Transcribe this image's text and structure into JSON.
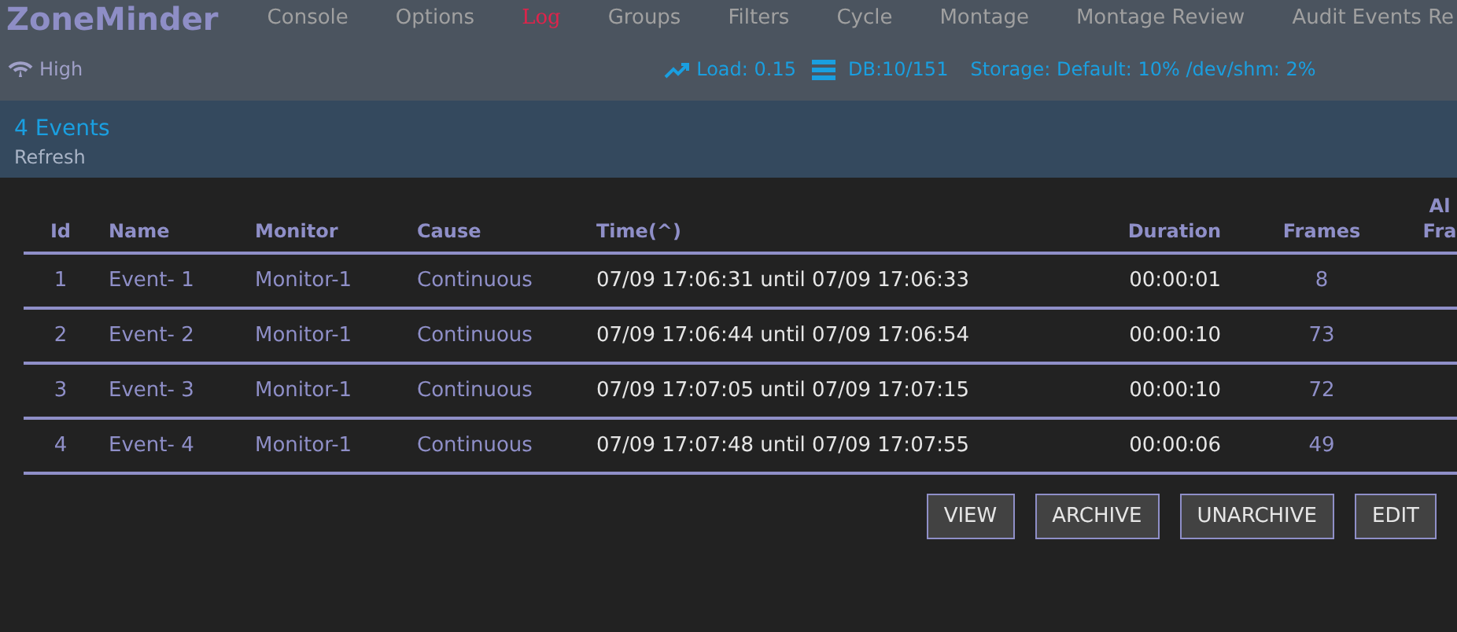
{
  "app_title": "ZoneMinder",
  "nav": [
    {
      "label": "Console",
      "selected": false
    },
    {
      "label": "Options",
      "selected": false
    },
    {
      "label": "Log",
      "selected": true
    },
    {
      "label": "Groups",
      "selected": false
    },
    {
      "label": "Filters",
      "selected": false
    },
    {
      "label": "Cycle",
      "selected": false
    },
    {
      "label": "Montage",
      "selected": false
    },
    {
      "label": "Montage Review",
      "selected": false
    },
    {
      "label": "Audit Events Re",
      "selected": false
    }
  ],
  "status": {
    "bandwidth": "High",
    "load": "Load: 0.15",
    "db": "DB:10/151",
    "storage": "Storage: Default: 10% /dev/shm: 2%"
  },
  "events_title": "4 Events",
  "refresh": "Refresh",
  "table": {
    "columns": [
      "Id",
      "Name",
      "Monitor",
      "Cause",
      "Time(^)",
      "Duration",
      "Frames",
      [
        "Al",
        "Fra"
      ]
    ],
    "rows": [
      [
        "1",
        "Event- 1",
        "Monitor-1",
        "Continuous",
        "07/09 17:06:31 until 07/09 17:06:33",
        "00:00:01",
        "8"
      ],
      [
        "2",
        "Event- 2",
        "Monitor-1",
        "Continuous",
        "07/09 17:06:44 until 07/09 17:06:54",
        "00:00:10",
        "73"
      ],
      [
        "3",
        "Event- 3",
        "Monitor-1",
        "Continuous",
        "07/09 17:07:05 until 07/09 17:07:15",
        "00:00:10",
        "72"
      ],
      [
        "4",
        "Event- 4",
        "Monitor-1",
        "Continuous",
        "07/09 17:07:48 until 07/09 17:07:55",
        "00:00:06",
        "49"
      ]
    ]
  },
  "buttons": [
    "VIEW",
    "ARCHIVE",
    "UNARCHIVE",
    "EDIT"
  ]
}
